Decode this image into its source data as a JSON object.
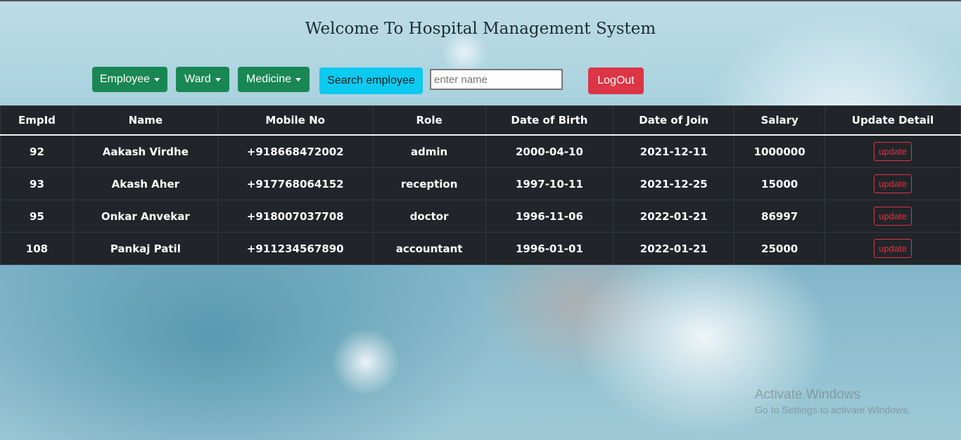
{
  "header": {
    "title": "Welcome To Hospital Management System"
  },
  "nav": {
    "employee": "Employee",
    "ward": "Ward",
    "medicine": "Medicine",
    "search_button": "Search employee",
    "search_placeholder": "enter name",
    "logout": "LogOut"
  },
  "table": {
    "headers": [
      "EmpId",
      "Name",
      "Mobile No",
      "Role",
      "Date of Birth",
      "Date of Join",
      "Salary",
      "Update Detail"
    ],
    "rows": [
      {
        "empid": "92",
        "name": "Aakash Virdhe",
        "mobile": "+918668472002",
        "role": "admin",
        "dob": "2000-04-10",
        "doj": "2021-12-11",
        "salary": "1000000",
        "action": "update"
      },
      {
        "empid": "93",
        "name": "Akash Aher",
        "mobile": "+917768064152",
        "role": "reception",
        "dob": "1997-10-11",
        "doj": "2021-12-25",
        "salary": "15000",
        "action": "update"
      },
      {
        "empid": "95",
        "name": "Onkar Anvekar",
        "mobile": "+918007037708",
        "role": "doctor",
        "dob": "1996-11-06",
        "doj": "2022-01-21",
        "salary": "86997",
        "action": "update"
      },
      {
        "empid": "108",
        "name": "Pankaj Patil",
        "mobile": "+911234567890",
        "role": "accountant",
        "dob": "1996-01-01",
        "doj": "2022-01-21",
        "salary": "25000",
        "action": "update"
      }
    ]
  },
  "watermark": {
    "line1": "Activate Windows",
    "line2": "Go to Settings to activate Windows."
  },
  "colors": {
    "success": "#198754",
    "info": "#0dcaf0",
    "danger": "#dc3545",
    "table_bg": "#212529"
  }
}
